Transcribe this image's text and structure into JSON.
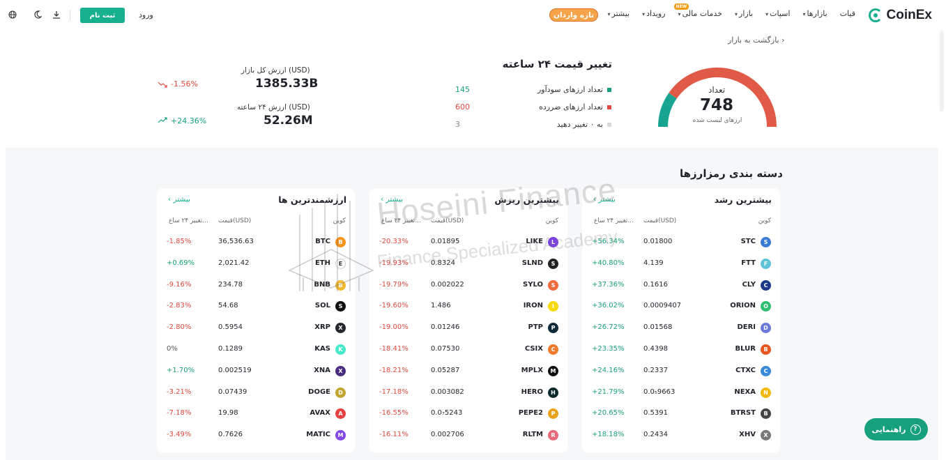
{
  "header": {
    "logo_text": "CoinEx",
    "nav": [
      {
        "label": "قیات",
        "caret": false
      },
      {
        "label": "بازارها",
        "caret": true
      },
      {
        "label": "اسپات",
        "caret": true
      },
      {
        "label": "بازار",
        "caret": true
      },
      {
        "label": "خدمات مالی",
        "caret": true,
        "badge": "NEW"
      },
      {
        "label": "رویداد",
        "caret": true
      },
      {
        "label": "بیشتر",
        "caret": true
      }
    ],
    "promo_label": "تازه واردان",
    "login_label": "ورود",
    "signup_label": "ثبت نام"
  },
  "back_label": "بازگشت به بازار",
  "gauge": {
    "label": "تعداد",
    "value": "748",
    "sub": "ارزهای لیست شده",
    "gainers_fraction": 0.194,
    "colors": {
      "gainers": "#17a592",
      "losers": "#e15a47"
    }
  },
  "change24": {
    "title": "تغییر قیمت ۲۴ ساعته",
    "rows": [
      {
        "label": "تعداد ارزهای سودآور",
        "value": "145",
        "color": "#17a07c"
      },
      {
        "label": "تعداد ارزهای ضررده",
        "value": "600",
        "color": "#e0493e"
      },
      {
        "label": "به ۰ تغییر دهید",
        "value": "3",
        "color": "#d9d9d9"
      }
    ]
  },
  "market": {
    "cap_label": "ارزش کل بازار (USD)",
    "cap_value": "1385.33B",
    "cap_change": "-1.56%",
    "vol_label": "ارزش ۲۴ ساعته (USD)",
    "vol_value": "52.26M",
    "vol_change": "+24.36%"
  },
  "category_title": "دسته بندی رمزارزها",
  "columns": {
    "coin": "کوین",
    "price": "قیمت(USD)",
    "change": "تغییر ۲۴ ساع..."
  },
  "more_label": "بیشتر",
  "cards": [
    {
      "title": "بیشترین رشد",
      "rows": [
        {
          "sym": "STC",
          "price": "0.01800",
          "pct": "+56.34%",
          "dir": "pos",
          "icon_color": "#3a7bd5",
          "icon": "stc-icon"
        },
        {
          "sym": "FTT",
          "price": "4.139",
          "pct": "+40.80%",
          "dir": "pos",
          "icon_color": "#5fc3d8",
          "icon": "ftt-icon"
        },
        {
          "sym": "CLY",
          "price": "0.1616",
          "pct": "+37.36%",
          "dir": "pos",
          "icon_color": "#1d3a8a",
          "icon": "cly-icon"
        },
        {
          "sym": "ORION",
          "price": "0.0009407",
          "pct": "+36.02%",
          "dir": "pos",
          "icon_color": "#2fbf71",
          "icon": "orion-icon"
        },
        {
          "sym": "DERI",
          "price": "0.01568",
          "pct": "+26.72%",
          "dir": "pos",
          "icon_color": "#6c7bd9",
          "icon": "deri-icon"
        },
        {
          "sym": "BLUR",
          "price": "0.4398",
          "pct": "+23.35%",
          "dir": "pos",
          "icon_color": "#e8571f",
          "icon": "blur-icon"
        },
        {
          "sym": "CTXC",
          "price": "0.2337",
          "pct": "+24.16%",
          "dir": "pos",
          "icon_color": "#3a8ad9",
          "icon": "ctxc-icon"
        },
        {
          "sym": "NEXA",
          "price": "0.0₅9663",
          "pct": "+21.79%",
          "dir": "pos",
          "icon_color": "#f0b90b",
          "icon": "nexa-icon"
        },
        {
          "sym": "BTRST",
          "price": "0.5391",
          "pct": "+20.65%",
          "dir": "pos",
          "icon_color": "#444444",
          "icon": "btrst-icon"
        },
        {
          "sym": "XHV",
          "price": "0.2434",
          "pct": "+18.18%",
          "dir": "pos",
          "icon_color": "#777777",
          "icon": "xhv-icon"
        }
      ]
    },
    {
      "title": "بیشترین ریزش",
      "rows": [
        {
          "sym": "LIKE",
          "price": "0.01895",
          "pct": "-20.33%",
          "dir": "neg",
          "icon_color": "#7b3fe4",
          "icon": "like-icon"
        },
        {
          "sym": "SLND",
          "price": "0.8324",
          "pct": "-19.93%",
          "dir": "neg",
          "icon_color": "#222222",
          "icon": "slnd-icon"
        },
        {
          "sym": "SYLO",
          "price": "0.002022",
          "pct": "-19.79%",
          "dir": "neg",
          "icon_color": "#f06a3b",
          "icon": "sylo-icon"
        },
        {
          "sym": "IRON",
          "price": "1.486",
          "pct": "-19.60%",
          "dir": "neg",
          "icon_color": "#f5d90a",
          "icon": "iron-icon"
        },
        {
          "sym": "PTP",
          "price": "0.01246",
          "pct": "-19.00%",
          "dir": "neg",
          "icon_color": "#0e2a3a",
          "icon": "ptp-icon"
        },
        {
          "sym": "CSIX",
          "price": "0.07530",
          "pct": "-18.41%",
          "dir": "neg",
          "icon_color": "#f07a2b",
          "icon": "csix-icon"
        },
        {
          "sym": "MPLX",
          "price": "0.05287",
          "pct": "-18.21%",
          "dir": "neg",
          "icon_color": "#111111",
          "icon": "mplx-icon"
        },
        {
          "sym": "HERO",
          "price": "0.003082",
          "pct": "-17.18%",
          "dir": "neg",
          "icon_color": "#0b2b2b",
          "icon": "hero-icon"
        },
        {
          "sym": "PEPE2",
          "price": "0.0₇5243",
          "pct": "-16.55%",
          "dir": "neg",
          "icon_color": "#e8a21c",
          "icon": "pepe2-icon"
        },
        {
          "sym": "RLTM",
          "price": "0.002706",
          "pct": "-16.11%",
          "dir": "neg",
          "icon_color": "#e86a7a",
          "icon": "rltm-icon"
        }
      ]
    },
    {
      "title": "ارزشمندترین ها",
      "rows": [
        {
          "sym": "BTC",
          "price": "36,536.63",
          "pct": "-1.85%",
          "dir": "neg",
          "icon_color": "#f7931a",
          "icon": "btc-icon"
        },
        {
          "sym": "ETH",
          "price": "2,021.42",
          "pct": "+0.69%",
          "dir": "pos",
          "icon_color": "#ffffff",
          "icon": "eth-icon"
        },
        {
          "sym": "BNB",
          "price": "234.78",
          "pct": "-9.16%",
          "dir": "neg",
          "icon_color": "#f3ba2f",
          "icon": "bnb-icon"
        },
        {
          "sym": "SOL",
          "price": "54.68",
          "pct": "-2.83%",
          "dir": "neg",
          "icon_color": "#111111",
          "icon": "sol-icon"
        },
        {
          "sym": "XRP",
          "price": "0.5954",
          "pct": "-2.80%",
          "dir": "neg",
          "icon_color": "#23292f",
          "icon": "xrp-icon"
        },
        {
          "sym": "KAS",
          "price": "0.1289",
          "pct": "0%",
          "dir": "neu",
          "icon_color": "#49eacb",
          "icon": "kas-icon"
        },
        {
          "sym": "XNA",
          "price": "0.002519",
          "pct": "+1.70%",
          "dir": "pos",
          "icon_color": "#4b2d7f",
          "icon": "xna-icon"
        },
        {
          "sym": "DOGE",
          "price": "0.07439",
          "pct": "-3.21%",
          "dir": "neg",
          "icon_color": "#c2a633",
          "icon": "doge-icon"
        },
        {
          "sym": "AVAX",
          "price": "19.98",
          "pct": "-7.18%",
          "dir": "neg",
          "icon_color": "#e84142",
          "icon": "avax-icon"
        },
        {
          "sym": "MATIC",
          "price": "0.7626",
          "pct": "-3.49%",
          "dir": "neg",
          "icon_color": "#8247e5",
          "icon": "matic-icon"
        }
      ]
    }
  ],
  "help_label": "راهنمایی",
  "watermark": {
    "line1": "Hoseini Finance",
    "line2": "Finance Specialized Academy"
  }
}
